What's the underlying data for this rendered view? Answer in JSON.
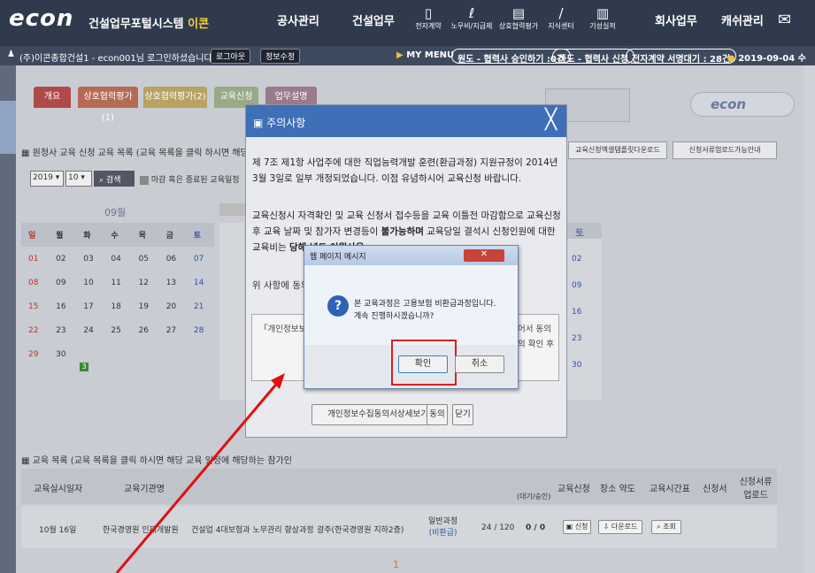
{
  "topbar": {
    "logo": "econ",
    "system_title": "건설업무포털시스템",
    "system_title_accent": "이콘",
    "nav": [
      "공사관리",
      "건설업무"
    ],
    "nav_right": [
      "회사업무",
      "캐쉬관리"
    ],
    "icons": [
      {
        "label": "전자계약"
      },
      {
        "label": "노무비/지급제"
      },
      {
        "label": "상호협력평가"
      },
      {
        "label": "지식센터"
      },
      {
        "label": "기성실적"
      }
    ]
  },
  "subbar": {
    "user_text": "(주)이콘종합건설1 - econ001님 로그인하셨습니다.",
    "logout": "로그아웃",
    "info_edit": "정보수정",
    "my_menu": "MY MENU",
    "pill1": "원도 - 협력사 승인하기 :0건",
    "pill2": "하도 - 협력사 신청",
    "pill3": "전자계약 서명대기 : 28건",
    "date": "2019-09-04 수"
  },
  "tabs": [
    "개요",
    "상호협력평가(1)",
    "상호협력평가(2)",
    "교육신청",
    "업무설명"
  ],
  "section1_title": "원청사 교육 신청 교육 목록 (교육 목록을 클릭 하시면 해당 교육 일",
  "year_select": "2019",
  "month_select": "10",
  "search": "검색",
  "legend": "마감 혹은 종료된 교육일정",
  "calendar": {
    "month": "09월",
    "weekdays": [
      "일",
      "월",
      "화",
      "수",
      "목",
      "금",
      "토"
    ],
    "rows": [
      [
        "01",
        "02",
        "03",
        "04",
        "05",
        "06",
        "07"
      ],
      [
        "08",
        "09",
        "10",
        "11",
        "12",
        "13",
        "14"
      ],
      [
        "15",
        "16",
        "17",
        "18",
        "19",
        "20",
        "21"
      ],
      [
        "22",
        "23",
        "24",
        "25",
        "26",
        "27",
        "28"
      ],
      [
        "29",
        "30",
        "",
        "",
        "",
        "",
        ""
      ]
    ],
    "badge": "3"
  },
  "right_cal_days": [
    "02",
    "09",
    "16",
    "23",
    "30"
  ],
  "right_buttons": [
    "교육신청엑셀템플릿다운로드",
    "신청서류업로드가능안내"
  ],
  "section2_title": "교육 목록 (교육 목록을 클릭 하시면 해당 교육 일정에 해당하는 참가인",
  "table": {
    "headers": [
      "교육실시일자",
      "교육기관명",
      "교육신청",
      "장소 약도",
      "교육시간표",
      "신청서",
      "신청서류 업로드"
    ],
    "row": {
      "date": "10월 16일",
      "org": "한국경영원 인재개발원",
      "course": "건설업 4대보험과 노무관리 향상과정",
      "place": "광주(한국경영원 지하2층)",
      "kind": "일반과정",
      "kind2": "(비환급)",
      "seats": "24 / 120",
      "apply": "0 / 0",
      "apply_btn": "신청",
      "map_btn": "다운로드",
      "time_btn": "조회"
    },
    "sub_header": "(대기/승인)",
    "page": "1"
  },
  "dialog": {
    "title": "주의사항",
    "p1": "제 7조 제1항 사업주에 대한 직업능력개발 훈련(환급과정) 지원규정이 2014년 3월 3일로 일부 개정되었습니다. 이점 유념하시어 교육신청 바랍니다.",
    "p2a": "교육신청시 자격확인 및 교육 신청서 접수등을 교육 이틀전 마감함으로 교육신청후 교육 날짜 및 참가자 변경등이 ",
    "p2b": "불가능하며",
    "p2c": " 교육당일 결석시 신청인원에 대한 교육비는 ",
    "p2d": "당해 년도 이월사용",
    "p3": "위 사항에 동의하",
    "consent": "「개인정보보호법」 ... 서를 얻어야 합니다 ... 교육신청을 할 수",
    "consent_right": "어서 동의 의 확인 후",
    "btn_detail": "개인정보수집동의서상세보기",
    "btn_agree": "동의",
    "btn_close": "닫기"
  },
  "msgbox": {
    "title": "웹 페이지 메시지",
    "line1": "본 교육과정은 고용보험 비환급과정입니다.",
    "line2": "계속 진행하시겠습니까?",
    "ok": "확인",
    "cancel": "취소"
  }
}
